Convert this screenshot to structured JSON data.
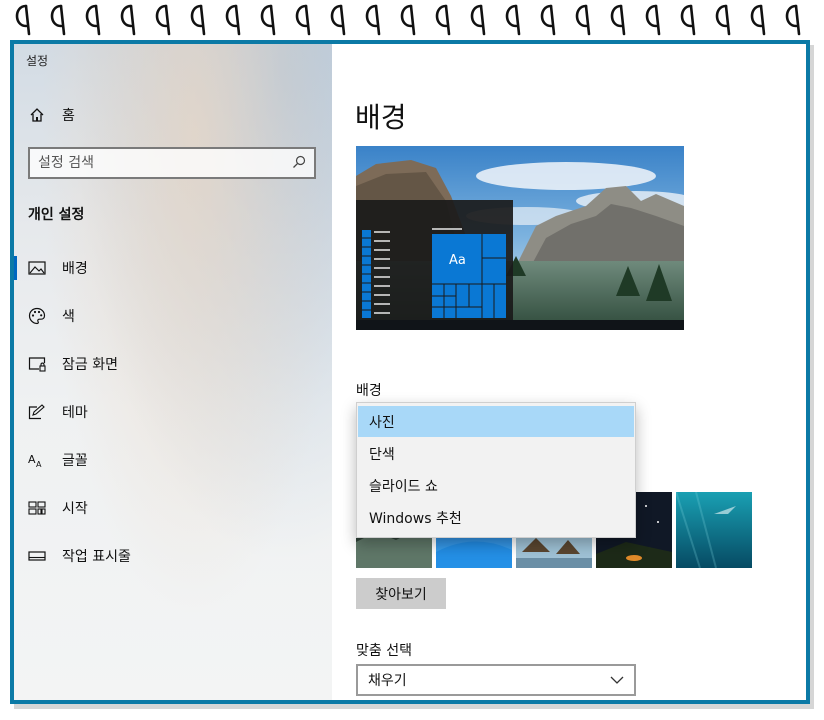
{
  "window": {
    "title": "설정"
  },
  "sidebar": {
    "home_label": "홈",
    "search_placeholder": "설정 검색",
    "section_heading": "개인 설정",
    "items": [
      {
        "label": "배경",
        "icon": "picture-icon",
        "active": true
      },
      {
        "label": "색",
        "icon": "palette-icon",
        "active": false
      },
      {
        "label": "잠금 화면",
        "icon": "lock-screen-icon",
        "active": false
      },
      {
        "label": "테마",
        "icon": "theme-icon",
        "active": false
      },
      {
        "label": "글꼴",
        "icon": "font-icon",
        "active": false
      },
      {
        "label": "시작",
        "icon": "start-icon",
        "active": false
      },
      {
        "label": "작업 표시줄",
        "icon": "taskbar-icon",
        "active": false
      }
    ]
  },
  "main": {
    "page_title": "배경",
    "preview": {
      "sample_text": "Aa"
    },
    "background_label": "배경",
    "background_options": [
      "사진",
      "단색",
      "슬라이드 쇼",
      "Windows 추천"
    ],
    "background_selected": "사진",
    "browse_button": "찾아보기",
    "fit_label": "맞춤 선택",
    "fit_value": "채우기"
  },
  "colors": {
    "accent": "#0067c0",
    "tile_blue": "#0a78d4",
    "frame_border": "#0c7aa6",
    "dropdown_highlight": "#a8d8f8"
  }
}
